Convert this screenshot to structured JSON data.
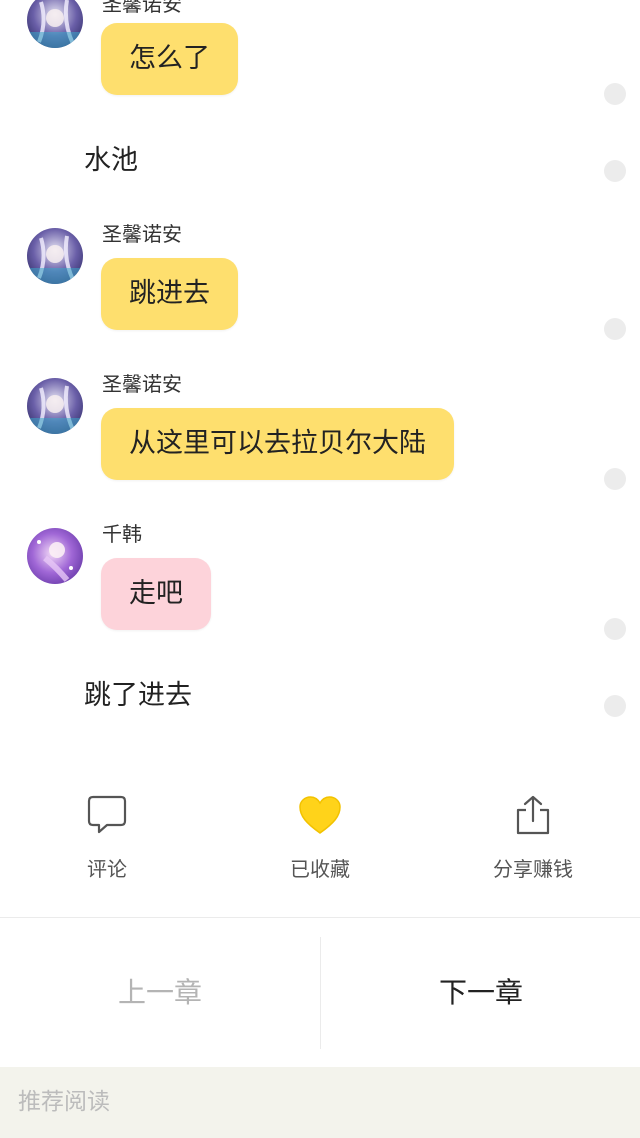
{
  "messages": [
    {
      "name": "圣馨诺安",
      "text": "怎么了"
    },
    {
      "narration": "水池"
    },
    {
      "name": "圣馨诺安",
      "text": "跳进去"
    },
    {
      "name": "圣馨诺安",
      "text": "从这里可以去拉贝尔大陆"
    },
    {
      "name": "千韩",
      "text": "走吧"
    },
    {
      "narration": "跳了进去"
    }
  ],
  "actions": {
    "comment": {
      "label": "评论",
      "icon": "speech-bubble-icon"
    },
    "favorite": {
      "label": "已收藏",
      "icon": "heart-icon",
      "color": "#ffd31a"
    },
    "share": {
      "label": "分享赚钱",
      "icon": "share-icon"
    }
  },
  "nav": {
    "prev_label": "上一章",
    "next_label": "下一章"
  },
  "recommend": {
    "label": "推荐阅读"
  },
  "colors": {
    "bubble_yellow": "#fedf6e",
    "bubble_pink": "#fdd3da",
    "recommend_bg": "#f3f3ec"
  }
}
